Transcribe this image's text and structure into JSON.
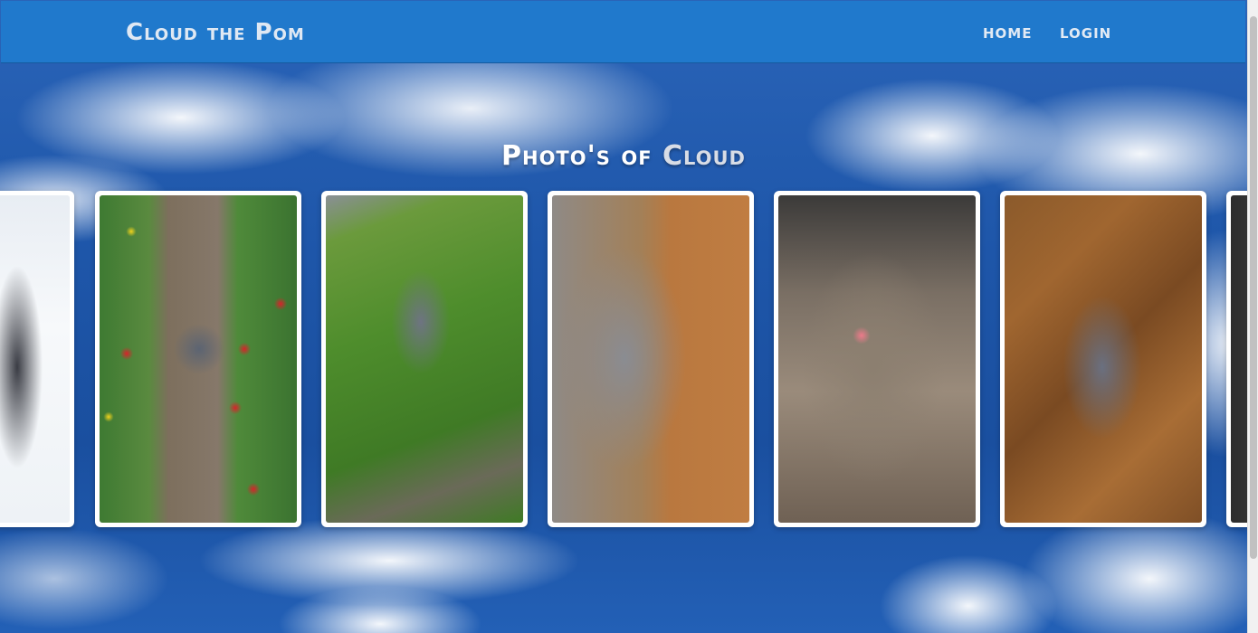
{
  "navbar": {
    "brand": "Cloud the Pom",
    "links": [
      "HOME",
      "LOGIN"
    ]
  },
  "heading": {
    "part1": "Photo's of ",
    "part2": "Cloud"
  },
  "gallery": {
    "photos": [
      {
        "subject": "snow"
      },
      {
        "subject": "tulips"
      },
      {
        "subject": "grass"
      },
      {
        "subject": "lying-down"
      },
      {
        "subject": "close-up-face"
      },
      {
        "subject": "autumn-leaves"
      },
      {
        "subject": "partial"
      }
    ]
  },
  "colors": {
    "navbar": "#2079cc",
    "sky": "#1e56a9",
    "card": "#ffffff"
  }
}
